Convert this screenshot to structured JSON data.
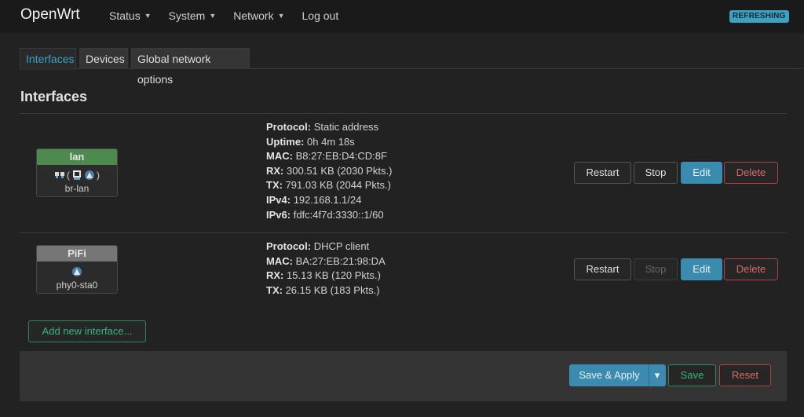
{
  "header": {
    "brand": "OpenWrt",
    "menu": [
      {
        "label": "Status",
        "dropdown": true
      },
      {
        "label": "System",
        "dropdown": true
      },
      {
        "label": "Network",
        "dropdown": true
      },
      {
        "label": "Log out",
        "dropdown": false
      }
    ],
    "badge": "REFRESHING"
  },
  "tabs": [
    {
      "label": "Interfaces",
      "active": true
    },
    {
      "label": "Devices",
      "active": false
    },
    {
      "label": "Global network options",
      "active": false
    }
  ],
  "section_title": "Interfaces",
  "interfaces": [
    {
      "name": "lan",
      "device": "br-lan",
      "icons": [
        "ethernet-icon",
        "bridge-icon",
        "wifi-icon"
      ],
      "details": [
        {
          "k": "Protocol:",
          "v": "Static address"
        },
        {
          "k": "Uptime:",
          "v": "0h 4m 18s"
        },
        {
          "k": "MAC:",
          "v": "B8:27:EB:D4:CD:8F"
        },
        {
          "k": "RX:",
          "v": "300.51 KB (2030 Pkts.)"
        },
        {
          "k": "TX:",
          "v": "791.03 KB (2044 Pkts.)"
        },
        {
          "k": "IPv4:",
          "v": "192.168.1.1/24"
        },
        {
          "k": "IPv6:",
          "v": "fdfc:4f7d:3330::1/60"
        }
      ],
      "buttons": {
        "restart": "Restart",
        "stop": "Stop",
        "edit": "Edit",
        "delete": "Delete"
      }
    },
    {
      "name": "PiFi",
      "device": "phy0-sta0",
      "icons": [
        "wifi-icon"
      ],
      "details": [
        {
          "k": "Protocol:",
          "v": "DHCP client"
        },
        {
          "k": "MAC:",
          "v": "BA:27:EB:21:98:DA"
        },
        {
          "k": "RX:",
          "v": "15.13 KB (120 Pkts.)"
        },
        {
          "k": "TX:",
          "v": "26.15 KB (183 Pkts.)"
        }
      ],
      "buttons": {
        "restart": "Restart",
        "stop": "Stop",
        "edit": "Edit",
        "delete": "Delete"
      }
    }
  ],
  "add_interface_label": "Add new interface...",
  "footer": {
    "save_apply": "Save & Apply",
    "dropdown_caret": "▾",
    "save": "Save",
    "reset": "Reset"
  },
  "colors": {
    "accent": "#3aa1c3",
    "lan_green": "#4e8a4e",
    "danger": "#a84545",
    "success": "#2e8a58"
  }
}
